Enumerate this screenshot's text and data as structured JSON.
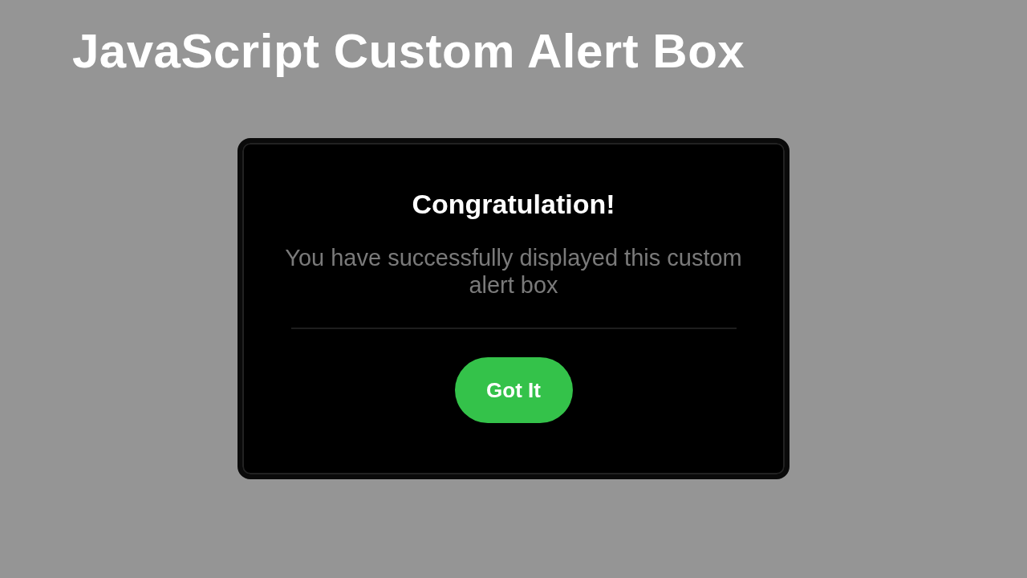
{
  "page_title": "JavaScript Custom Alert Box",
  "alert": {
    "title": "Congratulation!",
    "message": "You have successfully displayed this custom alert box",
    "button": "Got It"
  }
}
